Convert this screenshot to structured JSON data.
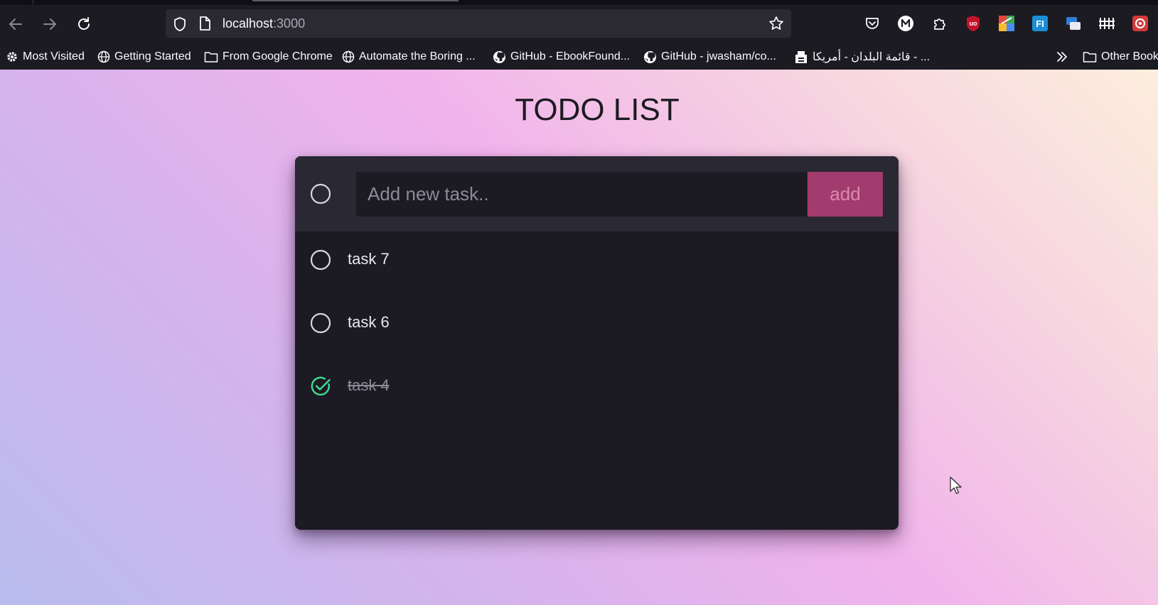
{
  "browser": {
    "url_host": "localhost",
    "url_port": ":3000",
    "bookmarks": [
      {
        "label": "Most Visited",
        "icon": "gear-icon"
      },
      {
        "label": "Getting Started",
        "icon": "globe-icon"
      },
      {
        "label": "From Google Chrome",
        "icon": "folder-icon"
      },
      {
        "label": "Automate the Boring ...",
        "icon": "globe-icon"
      },
      {
        "label": "GitHub - EbookFound...",
        "icon": "github-icon"
      },
      {
        "label": "GitHub - jwasham/co...",
        "icon": "github-icon"
      },
      {
        "label": "قائمة البلدان - أمريكا - ...",
        "icon": "bookmark-favicon"
      },
      {
        "label": "Other Book",
        "icon": "folder-icon"
      }
    ]
  },
  "app": {
    "title": "TODO LIST",
    "input_placeholder": "Add new task..",
    "add_label": "add",
    "tasks": [
      {
        "label": "task 7",
        "done": false
      },
      {
        "label": "task 6",
        "done": false
      },
      {
        "label": "task 4",
        "done": true
      }
    ]
  },
  "colors": {
    "accent": "#a23b6e",
    "done_check": "#3ddc97",
    "card_bg": "#1c1a22",
    "header_bg": "#2a2833"
  }
}
